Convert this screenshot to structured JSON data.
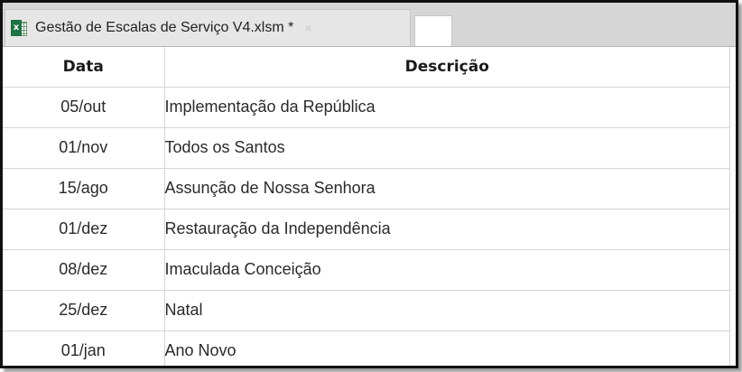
{
  "tab": {
    "title": "Gestão de Escalas de Serviço V4.xlsm *",
    "close": "×",
    "icon": "excel-icon",
    "icon_letter": "x"
  },
  "table": {
    "headers": [
      "Data",
      "Descrição"
    ],
    "rows": [
      {
        "date": "05/out",
        "desc": "Implementação da República"
      },
      {
        "date": "01/nov",
        "desc": "Todos os Santos"
      },
      {
        "date": "15/ago",
        "desc": "Assunção de Nossa Senhora"
      },
      {
        "date": "01/dez",
        "desc": "Restauração da Independência"
      },
      {
        "date": "08/dez",
        "desc": "Imaculada Conceição"
      },
      {
        "date": "25/dez",
        "desc": "Natal"
      },
      {
        "date": "01/jan",
        "desc": "Ano Novo"
      }
    ]
  }
}
